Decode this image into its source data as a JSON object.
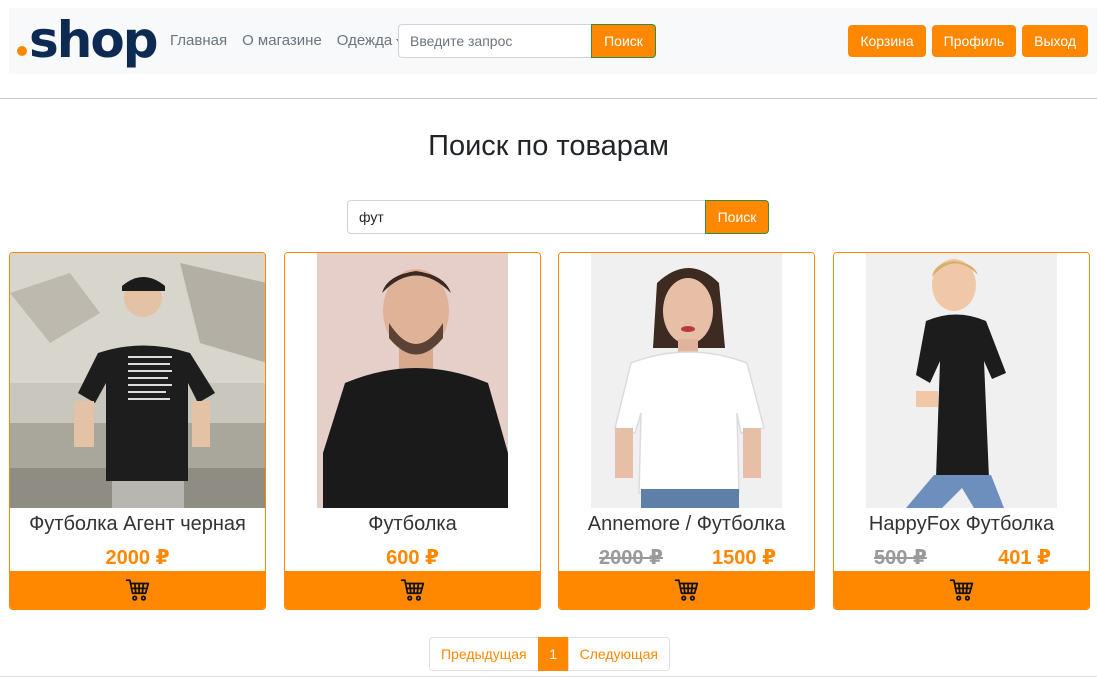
{
  "header": {
    "logo_text": "shop",
    "nav": {
      "home": "Главная",
      "about": "О магазине",
      "clothes": "Одежда"
    },
    "search": {
      "placeholder": "Введите запрос",
      "button": "Поиск"
    },
    "buttons": {
      "cart": "Корзина",
      "profile": "Профиль",
      "logout": "Выход"
    }
  },
  "main": {
    "title": "Поиск по товарам",
    "search": {
      "value": "фут",
      "button": "Поиск"
    }
  },
  "products": [
    {
      "title": "Футболка Агент черная",
      "price": "2000 ₽",
      "old_price": ""
    },
    {
      "title": "Футболка",
      "price": "600 ₽",
      "old_price": ""
    },
    {
      "title": "Annemore / Футболка",
      "price": "1500 ₽",
      "old_price": "2000 ₽"
    },
    {
      "title": "HappyFox Футболка",
      "price": "401 ₽",
      "old_price": "500 ₽"
    }
  ],
  "pagination": {
    "prev": "Предыдущая",
    "current": "1",
    "next": "Следующая"
  },
  "colors": {
    "accent": "#ff8800",
    "brand": "#0d2a52",
    "navbar_bg": "#f8f9fa"
  },
  "icons": {
    "cart": "shopping-cart-icon",
    "caret": "chevron-down-icon"
  }
}
